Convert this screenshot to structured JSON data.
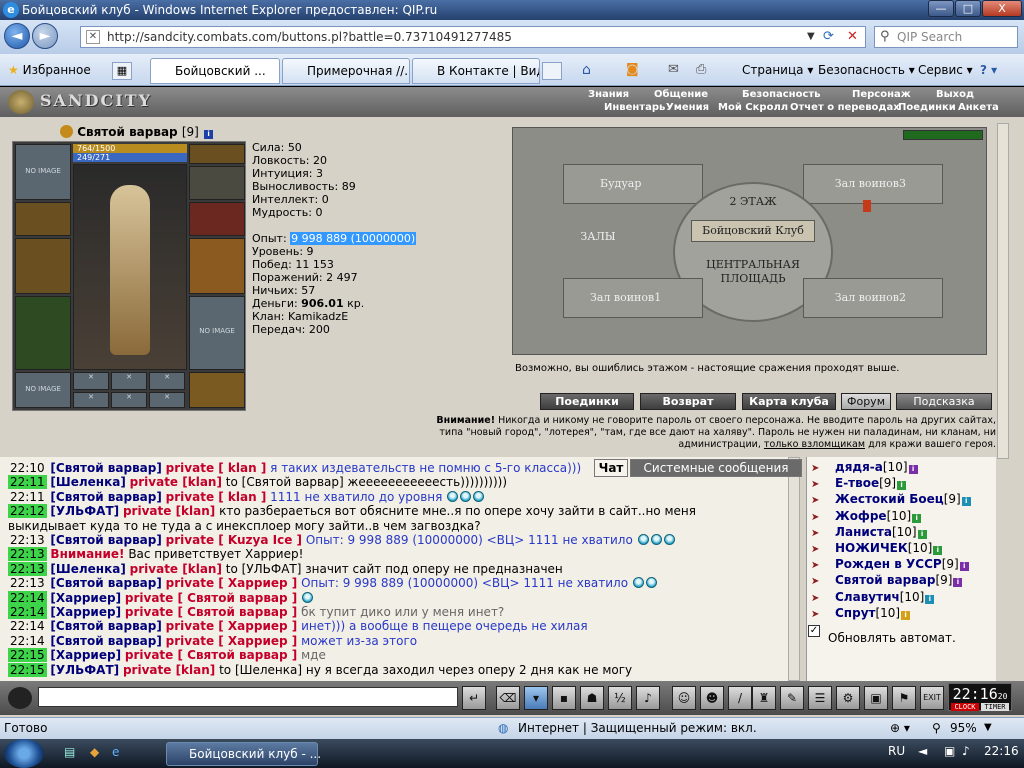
{
  "window": {
    "title": "Бойцовский клуб - Windows Internet Explorer предоставлен: QIP.ru",
    "app_icon_letter": "e",
    "min_label": "—",
    "max_label": "□",
    "close_label": "X"
  },
  "addressbar": {
    "url": "http://sandcity.combats.com/buttons.pl?battle=0.73710491277485",
    "search_placeholder": "QIP Search",
    "back_glyph": "◄",
    "forward_glyph": "►"
  },
  "tabsbar": {
    "favorites_label": "Избранное",
    "tabs": [
      {
        "label": "Бойцовский ..."
      },
      {
        "label": "Примерочная //..."
      },
      {
        "label": "В Контакте | Вид..."
      }
    ],
    "tools": [
      "Страница ▾",
      "Безопасность ▾",
      "Сервис ▾"
    ]
  },
  "game": {
    "logo": "SANDCITY",
    "menu_top": [
      "Знания",
      "Общение",
      "Безопасность",
      "Персонаж",
      "Выход"
    ],
    "menu_bottom": [
      "Инвентарь",
      "Умения",
      "Мой Скролл",
      "Отчет о переводах",
      "Поединки",
      "Анкета"
    ],
    "character": {
      "name": "Святой варвар",
      "level": "[9]",
      "hp": "764/1500",
      "mana": "249/271",
      "no_image": "NO IMAGE",
      "stats": [
        {
          "label": "Сила:",
          "value": "50"
        },
        {
          "label": "Ловкость:",
          "value": "20"
        },
        {
          "label": "Интуиция:",
          "value": "3"
        },
        {
          "label": "Выносливость:",
          "value": "89"
        },
        {
          "label": "Интеллект:",
          "value": "0"
        },
        {
          "label": "Мудрость:",
          "value": "0"
        }
      ],
      "exp_label": "Опыт:",
      "exp_value": "9 998 889 (10000000)",
      "info": [
        {
          "label": "Уровень:",
          "value": "9"
        },
        {
          "label": "Побед:",
          "value": "11 153"
        },
        {
          "label": "Поражений:",
          "value": "2 497"
        },
        {
          "label": "Ничьих:",
          "value": "57"
        }
      ],
      "money_label": "Деньги:",
      "money_value": "906.01",
      "money_unit": "кр.",
      "clan_label": "Клан:",
      "clan_value": "KamikadzE",
      "transfers_label": "Передач:",
      "transfers_value": "200"
    },
    "map": {
      "rooms": {
        "boudoir": "Будуар",
        "warriors3": "Зал воинов3",
        "floor2": "2 ЭТАЖ",
        "club": "Бойцовский Клуб",
        "halls": "ЗАЛЫ",
        "central": "ЦЕНТРАЛЬНАЯ ПЛОЩАДЬ",
        "warriors1": "Зал воинов1",
        "warriors2": "Зал воинов2"
      },
      "note": "Возможно, вы ошиблись этажом - настоящие сражения проходят выше."
    },
    "buttons": [
      "Поединки",
      "Возврат",
      "Карта клуба",
      "Форум",
      "Подсказка"
    ],
    "warning_bold": "Внимание!",
    "warning_text": "Никогда и никому не говорите пароль от своего персонажа. Не вводите пароль на других сайтах, типа \"новый город\", \"лотерея\", \"там, где все дают на халяву\". Пароль не нужен ни паладинам, ни кланам, ни администрации,",
    "warning_link": "только взломщикам",
    "warning_tail": "для кражи вашего героя."
  },
  "chat": {
    "tabs": [
      "Чат",
      "Системные сообщения"
    ],
    "lines": [
      {
        "time": "22:10",
        "hl": false,
        "nick": "[Святой варвар]",
        "priv": "private [ klan ]",
        "msg": "я таких издевательств не помню с 5-го класса)))",
        "style": "blue",
        "smiles": 0
      },
      {
        "time": "22:11",
        "hl": true,
        "nick": "[Шеленка]",
        "priv": "private [klan]",
        "msg": "to [Святой варвар] жееееееееееесть))))))))))",
        "style": "",
        "smiles": 0
      },
      {
        "time": "22:11",
        "hl": false,
        "nick": "[Святой варвар]",
        "priv": "private [ klan ]",
        "msg": "1111 не хватило до уровня",
        "style": "blue",
        "smiles": 3
      },
      {
        "time": "22:12",
        "hl": true,
        "nick": "[УЛЬФАТ]",
        "priv": "private [klan]",
        "msg": "кто разбераеться вот обясните мне..я по опере хочу зайти в сайт..но меня",
        "style": "",
        "smiles": 0
      },
      {
        "time": "",
        "hl": false,
        "nick": "",
        "priv": "",
        "msg": "выкидывает куда то не туда а с инексплоер могу зайти..в чем загвоздка?",
        "style": "",
        "smiles": 0
      },
      {
        "time": "22:13",
        "hl": false,
        "nick": "[Святой варвар]",
        "priv": "private [ Kuzya Ice ]",
        "msg": "Опыт: 9 998 889 (10000000) <ВЦ> 1111 не хватило",
        "style": "blue",
        "smiles": 3
      },
      {
        "time": "22:13",
        "hl": true,
        "nick": "",
        "priv": "Внимание!",
        "msg": "Вас приветствует Харриер!",
        "style": "",
        "smiles": 0
      },
      {
        "time": "22:13",
        "hl": true,
        "nick": "[Шеленка]",
        "priv": "private [klan]",
        "msg": "to [УЛЬФАТ] значит сайт под оперу не предназначен",
        "style": "",
        "smiles": 0
      },
      {
        "time": "22:13",
        "hl": false,
        "nick": "[Святой варвар]",
        "priv": "private [ Харриер ]",
        "msg": "Опыт: 9 998 889 (10000000) <ВЦ> 1111 не хватило",
        "style": "blue",
        "smiles": 2
      },
      {
        "time": "22:14",
        "hl": true,
        "nick": "[Харриер]",
        "priv": "private [ Святой варвар ]",
        "msg": "",
        "style": "",
        "smiles": 1
      },
      {
        "time": "22:14",
        "hl": true,
        "nick": "[Харриер]",
        "priv": "private [ Святой варвар ]",
        "msg": "бк тупит дико или у меня инет?",
        "style": "grey",
        "smiles": 0
      },
      {
        "time": "22:14",
        "hl": false,
        "nick": "[Святой варвар]",
        "priv": "private [ Харриер ]",
        "msg": "инет))) а вообще в пещере очередь не хилая",
        "style": "blue",
        "smiles": 0
      },
      {
        "time": "22:14",
        "hl": false,
        "nick": "[Святой варвар]",
        "priv": "private [ Харриер ]",
        "msg": "может из-за этого",
        "style": "blue",
        "smiles": 0
      },
      {
        "time": "22:15",
        "hl": true,
        "nick": "[Харриер]",
        "priv": "private [ Святой варвар ]",
        "msg": "мде",
        "style": "grey",
        "smiles": 0
      },
      {
        "time": "22:15",
        "hl": true,
        "nick": "[УЛЬФАТ]",
        "priv": "private [klan]",
        "msg": "to [Шеленка] ну я всегда заходил через оперу 2 дня как не могу",
        "style": "",
        "smiles": 0
      }
    ]
  },
  "online": {
    "users": [
      {
        "name": "дядя-а",
        "lvl": "[10]",
        "badge": "#7a2fa8"
      },
      {
        "name": "Е-твое",
        "lvl": "[9]",
        "badge": "#2a9a3a"
      },
      {
        "name": "Жестокий Боец",
        "lvl": "[9]",
        "badge": "#1d8fb5"
      },
      {
        "name": "Жофре",
        "lvl": "[10]",
        "badge": "#2a9a3a"
      },
      {
        "name": "Ланиста",
        "lvl": "[10]",
        "badge": "#2a9a3a"
      },
      {
        "name": "НОЖИЧЕК",
        "lvl": "[10]",
        "badge": "#2a9a3a"
      },
      {
        "name": "Рожден в УССР",
        "lvl": "[9]",
        "badge": "#7a2fa8"
      },
      {
        "name": "Святой варвар",
        "lvl": "[9]",
        "badge": "#7a2fa8"
      },
      {
        "name": "Славутич",
        "lvl": "[10]",
        "badge": "#1d8fb5"
      },
      {
        "name": "Спрут",
        "lvl": "[10]",
        "badge": "#d4a017"
      }
    ],
    "auto_update": "Обновлять автомат."
  },
  "clock": {
    "time": "22:16",
    "sec": "20",
    "label1": "CLOCK",
    "label2": "TIMER"
  },
  "status": {
    "ready": "Готово",
    "zone": "Интернет | Защищенный режим: вкл.",
    "zoom": "95%"
  },
  "taskbar": {
    "active_task": "Бойцовский клуб - ...",
    "lang": "RU",
    "time": "22:16"
  }
}
